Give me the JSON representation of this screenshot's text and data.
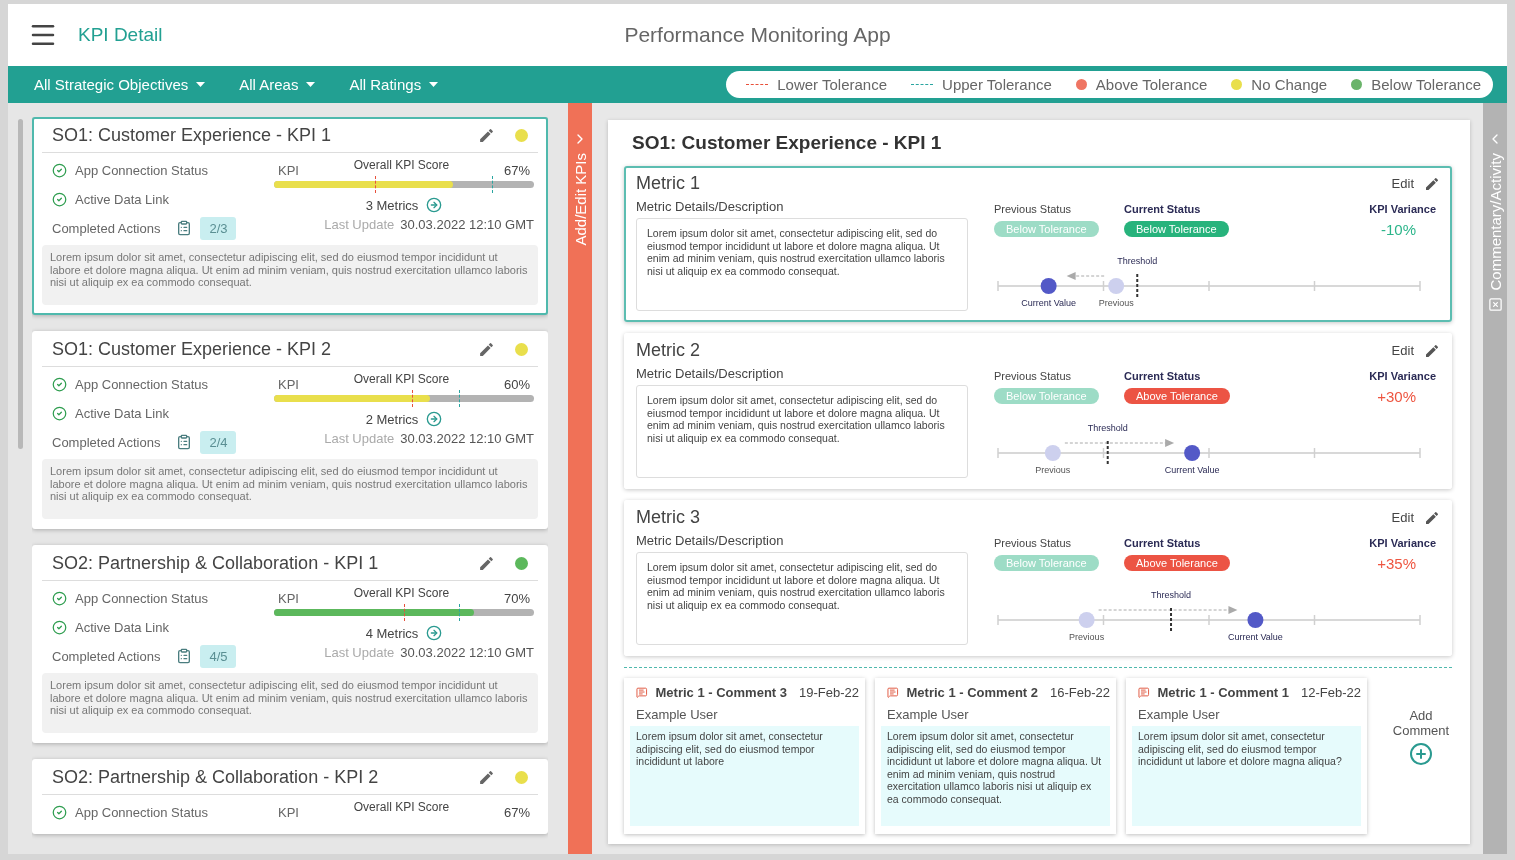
{
  "header": {
    "title": "KPI Detail",
    "app_title": "Performance Monitoring App"
  },
  "filters": [
    {
      "label": "All Strategic Objectives"
    },
    {
      "label": "All Areas"
    },
    {
      "label": "All Ratings"
    }
  ],
  "legend": [
    {
      "kind": "line",
      "label": "Lower Tolerance",
      "color": "#e8503a"
    },
    {
      "kind": "line",
      "label": "Upper Tolerance",
      "color": "#2aa5a0"
    },
    {
      "kind": "dot",
      "label": "Above Tolerance",
      "color": "#ef7563"
    },
    {
      "kind": "dot",
      "label": "No Change",
      "color": "#e9df4c"
    },
    {
      "kind": "dot",
      "label": "Below Tolerance",
      "color": "#6ab46a"
    }
  ],
  "kpi_panel": {
    "tab_label": "Add/Edit KPIs",
    "cards": [
      {
        "title": "SO1: Customer Experience - KPI 1",
        "selected": true,
        "color": "#e9df4c",
        "checks": [
          "App Connection Status",
          "Active Data Link"
        ],
        "actions_label": "Completed Actions",
        "actions_count": "2/3",
        "kpi_label": "KPI",
        "score_label": "Overall KPI Score",
        "score": "67%",
        "level": 0.69,
        "lower_tolerance": {
          "level": 0.39
        },
        "upper_tolerance": {
          "level": 0.84
        },
        "metrics_link": "3 Metrics",
        "update_label": "Last Update",
        "update_time": "30.03.2022 12:10 GMT",
        "description": "Lorem ipsum dolor sit amet, consectetur adipiscing elit, sed do eiusmod tempor incididunt ut labore et dolore magna aliqua. Ut enim ad minim veniam, quis nostrud exercitation ullamco laboris nisi ut aliquip ex ea commodo consequat."
      },
      {
        "title": "SO1: Customer Experience - KPI 2",
        "selected": false,
        "color": "#e9df4c",
        "checks": [
          "App Connection Status",
          "Active Data Link"
        ],
        "actions_label": "Completed Actions",
        "actions_count": "2/4",
        "kpi_label": "KPI",
        "score_label": "Overall KPI Score",
        "score": "60%",
        "level": 0.6,
        "lower_tolerance": {
          "level": 0.53
        },
        "upper_tolerance": {
          "level": 0.71
        },
        "metrics_link": "2 Metrics",
        "update_label": "Last Update",
        "update_time": "30.03.2022 12:10 GMT",
        "description": "Lorem ipsum dolor sit amet, consectetur adipiscing elit, sed do eiusmod tempor incididunt ut labore et dolore magna aliqua. Ut enim ad minim veniam, quis nostrud exercitation ullamco laboris nisi ut aliquip ex ea commodo consequat."
      },
      {
        "title": "SO2: Partnership & Collaboration - KPI 1",
        "selected": false,
        "color": "#5cb85c",
        "checks": [
          "App Connection Status",
          "Active Data Link"
        ],
        "actions_label": "Completed Actions",
        "actions_count": "4/5",
        "kpi_label": "KPI",
        "score_label": "Overall KPI Score",
        "score": "70%",
        "level": 0.77,
        "lower_tolerance": {
          "level": 0.5
        },
        "upper_tolerance": {
          "level": 0.71
        },
        "metrics_link": "4 Metrics",
        "update_label": "Last Update",
        "update_time": "30.03.2022 12:10 GMT",
        "description": "Lorem ipsum dolor sit amet, consectetur adipiscing elit, sed do eiusmod tempor incididunt ut labore et dolore magna aliqua. Ut enim ad minim veniam, quis nostrud exercitation ullamco laboris nisi ut aliquip ex ea commodo consequat."
      },
      {
        "title": "SO2: Partnership & Collaboration - KPI 2",
        "selected": false,
        "color": "#e9df4c",
        "checks": [
          "App Connection Status"
        ],
        "kpi_label": "KPI",
        "score_label": "Overall KPI Score",
        "score": "67%"
      }
    ]
  },
  "detail": {
    "title": "SO1: Customer Experience - KPI 1",
    "metrics": [
      {
        "title": "Metric 1",
        "selected": true,
        "edit_label": "Edit",
        "details_label": "Metric Details/Description",
        "description": "Lorem ipsum dolor sit amet, consectetur adipiscing elit, sed do eiusmod tempor incididunt ut labore et dolore magna aliqua. Ut enim ad minim veniam, quis nostrud exercitation ullamco laboris nisi ut aliquip ex ea commodo consequat.",
        "previous_status": {
          "label": "Previous Status",
          "value": "Below Tolerance",
          "kind": "below"
        },
        "current_status": {
          "label": "Current Status",
          "value": "Below Tolerance",
          "kind": "below"
        },
        "variance": {
          "label": "KPI Variance",
          "value": "-10%",
          "kind": "below"
        },
        "threshold": {
          "label": "Threshold",
          "level": 0.33
        },
        "current": {
          "label": "Current Value",
          "level": 0.12
        },
        "previous": {
          "label": "Previous",
          "level": 0.28
        }
      },
      {
        "title": "Metric 2",
        "selected": false,
        "edit_label": "Edit",
        "details_label": "Metric Details/Description",
        "description": "Lorem ipsum dolor sit amet, consectetur adipiscing elit, sed do eiusmod tempor incididunt ut labore et dolore magna aliqua. Ut enim ad minim veniam, quis nostrud exercitation ullamco laboris nisi ut aliquip ex ea commodo consequat.",
        "previous_status": {
          "label": "Previous Status",
          "value": "Below Tolerance",
          "kind": "below"
        },
        "current_status": {
          "label": "Current Status",
          "value": "Above Tolerance",
          "kind": "above"
        },
        "variance": {
          "label": "KPI Variance",
          "value": "+30%",
          "kind": "above"
        },
        "threshold": {
          "label": "Threshold",
          "level": 0.26
        },
        "current": {
          "label": "Current Value",
          "level": 0.46
        },
        "previous": {
          "label": "Previous",
          "level": 0.13
        }
      },
      {
        "title": "Metric 3",
        "selected": false,
        "edit_label": "Edit",
        "details_label": "Metric Details/Description",
        "description": "Lorem ipsum dolor sit amet, consectetur adipiscing elit, sed do eiusmod tempor incididunt ut labore et dolore magna aliqua. Ut enim ad minim veniam, quis nostrud exercitation ullamco laboris nisi ut aliquip ex ea commodo consequat.",
        "previous_status": {
          "label": "Previous Status",
          "value": "Below Tolerance",
          "kind": "below"
        },
        "current_status": {
          "label": "Current Status",
          "value": "Above Tolerance",
          "kind": "above"
        },
        "variance": {
          "label": "KPI Variance",
          "value": "+35%",
          "kind": "above"
        },
        "threshold": {
          "label": "Threshold",
          "level": 0.41
        },
        "current": {
          "label": "Current Value",
          "level": 0.61
        },
        "previous": {
          "label": "Previous",
          "level": 0.21
        }
      }
    ],
    "comments": [
      {
        "title": "Metric 1 - Comment 3",
        "date": "19-Feb-22",
        "user": "Example User",
        "text": "Lorem ipsum dolor sit amet, consectetur adipiscing elit, sed do eiusmod tempor incididunt ut labore"
      },
      {
        "title": "Metric 1 - Comment 2",
        "date": "16-Feb-22",
        "user": "Example User",
        "text": "Lorem ipsum dolor sit amet, consectetur adipiscing elit, sed do eiusmod tempor incididunt ut labore et dolore magna aliqua. Ut enim ad minim veniam, quis nostrud exercitation ullamco laboris nisi ut aliquip ex ea commodo consequat."
      },
      {
        "title": "Metric 1 - Comment 1",
        "date": "12-Feb-22",
        "user": "Example User",
        "text": "Lorem ipsum dolor sit amet, consectetur adipiscing elit, sed do eiusmod tempor incididunt ut labore et dolore magna aliqua?"
      }
    ],
    "add_comment": "Add Comment"
  },
  "side_panel": {
    "label": "Commentary/Activity"
  }
}
